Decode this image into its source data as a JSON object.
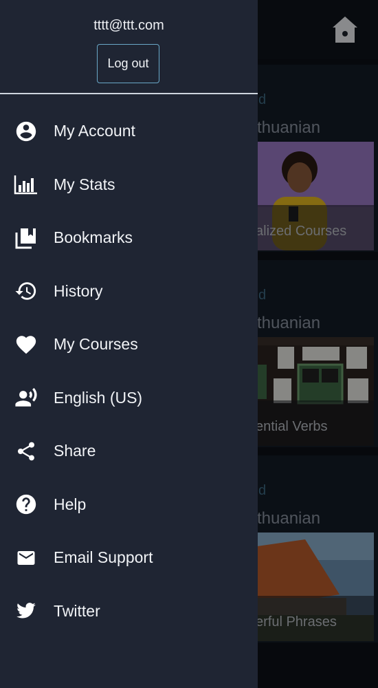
{
  "drawer": {
    "account_email": "tttt@ttt.com",
    "logout_label": "Log out",
    "items": [
      {
        "label": "My Account",
        "icon": "account-circle-icon"
      },
      {
        "label": "My Stats",
        "icon": "bar-chart-icon"
      },
      {
        "label": "Bookmarks",
        "icon": "bookmarks-icon"
      },
      {
        "label": "History",
        "icon": "history-icon"
      },
      {
        "label": "My Courses",
        "icon": "heart-icon"
      },
      {
        "label": "English (US)",
        "icon": "voice-language-icon"
      },
      {
        "label": "Share",
        "icon": "share-icon"
      },
      {
        "label": "Help",
        "icon": "help-icon"
      },
      {
        "label": "Email Support",
        "icon": "envelope-icon"
      },
      {
        "label": "Twitter",
        "icon": "twitter-icon"
      }
    ]
  },
  "background": {
    "home_icon": "home-icon",
    "cards": [
      {
        "tag": "d",
        "language": "thuanian",
        "caption": "alized Courses"
      },
      {
        "tag": "d",
        "language": "thuanian",
        "caption": "ential Verbs"
      },
      {
        "tag": "d",
        "language": "thuanian",
        "caption": "erful Phrases"
      }
    ]
  },
  "colors": {
    "drawer_bg": "#1f2533",
    "page_bg": "#0d1117",
    "text": "#f1f3f6",
    "logout_border": "#6aa9c9"
  }
}
